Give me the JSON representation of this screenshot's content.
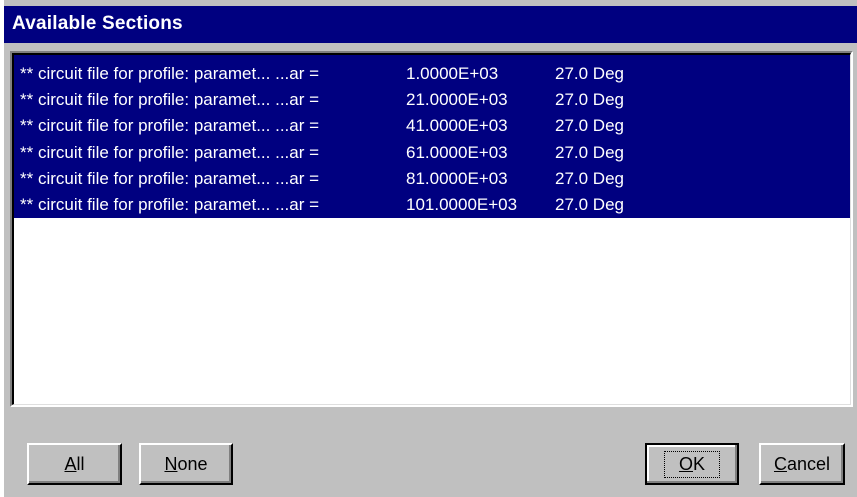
{
  "dialog": {
    "title": "Available Sections",
    "items": [
      {
        "prefix": "** circuit file for profile: paramet... ...ar =",
        "value": "1.0000E+03",
        "angle": "27.0 Deg"
      },
      {
        "prefix": "** circuit file for profile: paramet... ...ar =",
        "value": "21.0000E+03",
        "angle": "27.0 Deg"
      },
      {
        "prefix": "** circuit file for profile: paramet... ...ar =",
        "value": "41.0000E+03",
        "angle": "27.0 Deg"
      },
      {
        "prefix": "** circuit file for profile: paramet... ...ar =",
        "value": "61.0000E+03",
        "angle": "27.0 Deg"
      },
      {
        "prefix": "** circuit file for profile: paramet... ...ar =",
        "value": "81.0000E+03",
        "angle": "27.0 Deg"
      },
      {
        "prefix": "** circuit file for profile: paramet... ...ar =",
        "value": "101.0000E+03",
        "angle": "27.0 Deg"
      }
    ],
    "buttons": {
      "all": {
        "first": "A",
        "rest": "ll"
      },
      "none": {
        "first": "N",
        "rest": "one"
      },
      "ok": {
        "first": "O",
        "rest": "K"
      },
      "cancel": {
        "first": "C",
        "rest": "ancel"
      }
    }
  },
  "colors": {
    "selection": "#000080",
    "face": "#c0c0c0",
    "text_selected": "#ffffff"
  }
}
